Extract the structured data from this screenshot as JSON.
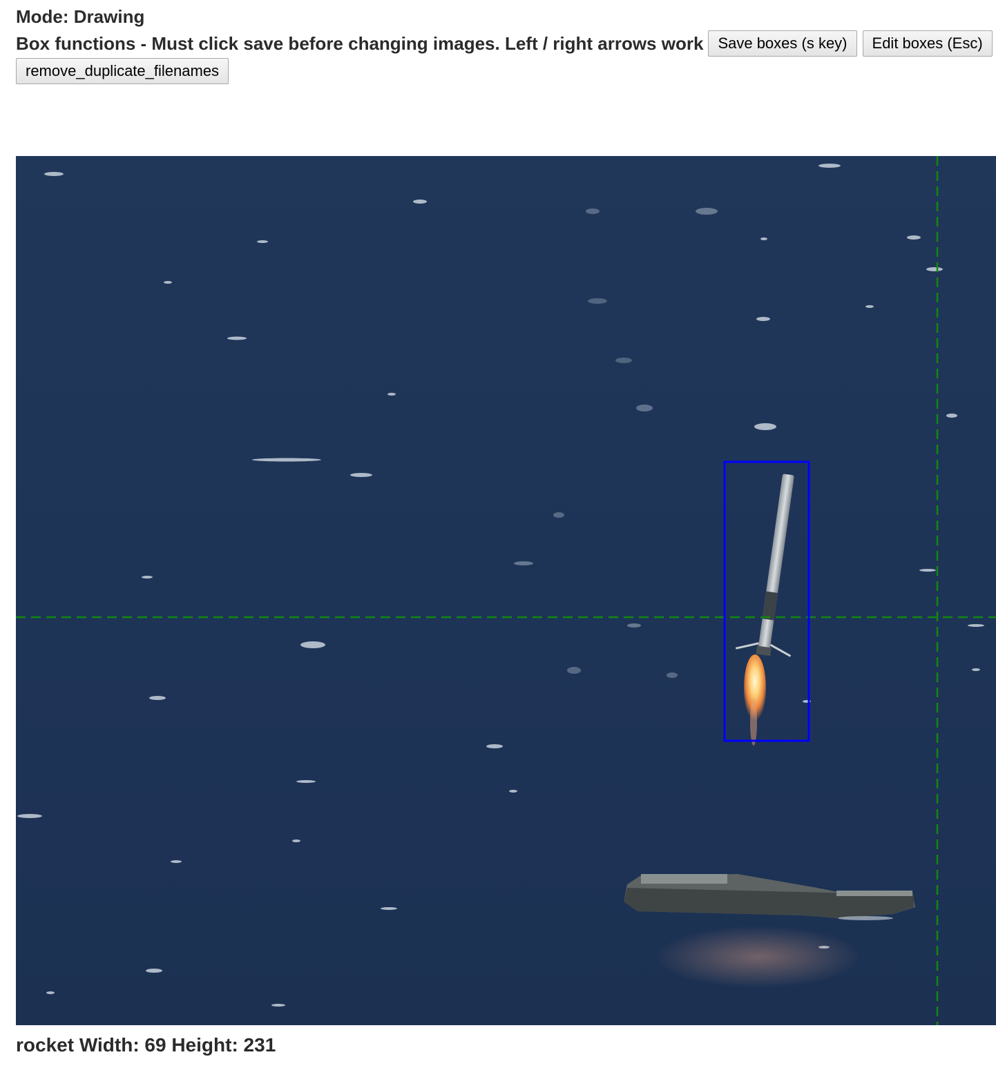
{
  "header": {
    "mode_label": "Mode: Drawing",
    "functions_text": "Box functions - Must click save before changing images. Left / right arrows work"
  },
  "toolbar": {
    "save_label": "Save boxes (s key)",
    "edit_label": "Edit boxes (Esc)",
    "remove_duplicates_label": "remove_duplicate_filenames"
  },
  "annotation": {
    "label": "rocket",
    "box_stroke_color": "#0000ff"
  },
  "status": {
    "text": "rocket Width: 69 Height: 231"
  },
  "colors": {
    "sea": "#1f3558",
    "crosshair": "#118811",
    "box": "#0000ff"
  }
}
